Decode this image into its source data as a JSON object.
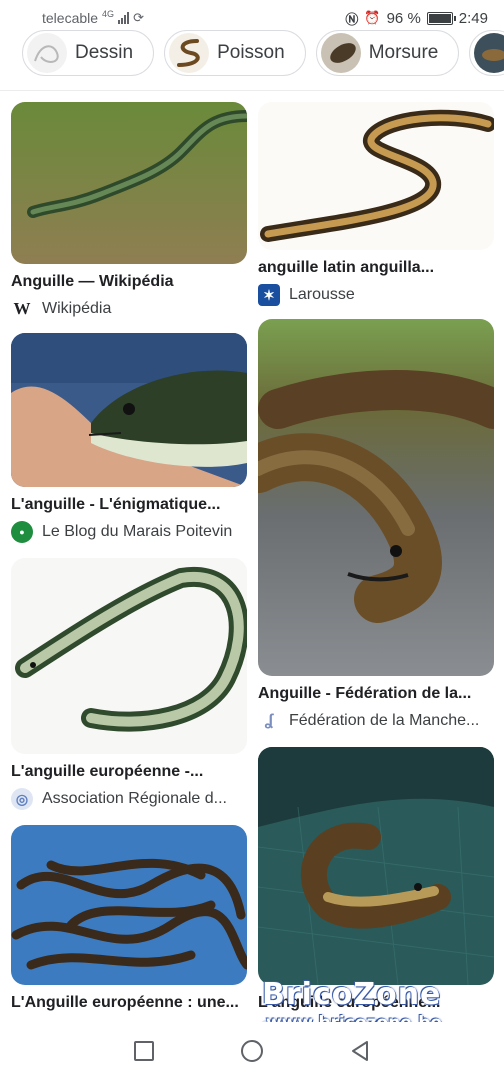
{
  "status_bar": {
    "carrier": "telecable",
    "network": "4G",
    "battery": "96 %",
    "time": "2:49"
  },
  "chips": [
    {
      "label": "Dessin",
      "icon": "eel-drawing-thumbnail"
    },
    {
      "label": "Poisson",
      "icon": "eel-fish-thumbnail"
    },
    {
      "label": "Morsure",
      "icon": "eel-bite-thumbnail"
    },
    {
      "label": "",
      "icon": "eel-thumbnail"
    }
  ],
  "results": {
    "left": [
      {
        "title": "Anguille — Wikipédia",
        "source": "Wikipédia",
        "favicon": "W",
        "favicon_color": "#202124",
        "favicon_bg": "#ffffff"
      },
      {
        "title": "L'anguille - L'énigmatique...",
        "source": "Le Blog du Marais Poitevin",
        "favicon": "●",
        "favicon_color": "#1e8e3e",
        "favicon_bg": "#ffffff"
      },
      {
        "title": "L'anguille européenne -...",
        "source": "Association Régionale d...",
        "favicon": "◎",
        "favicon_color": "#5f7fbf",
        "favicon_bg": "#ffffff"
      },
      {
        "title": "L'Anguille européenne : une...",
        "source": "",
        "favicon": "≡",
        "favicon_color": "#202124",
        "favicon_bg": "#ffffff"
      }
    ],
    "right": [
      {
        "title": "anguille latin anguilla...",
        "source": "Larousse",
        "favicon": "✶",
        "favicon_color": "#ffffff",
        "favicon_bg": "#1a4fa0"
      },
      {
        "title": "Anguille - Fédération de la...",
        "source": "Fédération de la Manche...",
        "favicon": "ʆ",
        "favicon_color": "#7a8fc0",
        "favicon_bg": "#ffffff"
      },
      {
        "title": "L'anguille européenne...",
        "source": "",
        "favicon": "◎",
        "favicon_color": "#5f7fbf",
        "favicon_bg": "#ffffff"
      }
    ]
  },
  "watermark": {
    "brand": "BricoZone",
    "url": "www.bricozone.be"
  },
  "navbar": {
    "buttons": [
      "recent-apps",
      "home",
      "back"
    ]
  }
}
